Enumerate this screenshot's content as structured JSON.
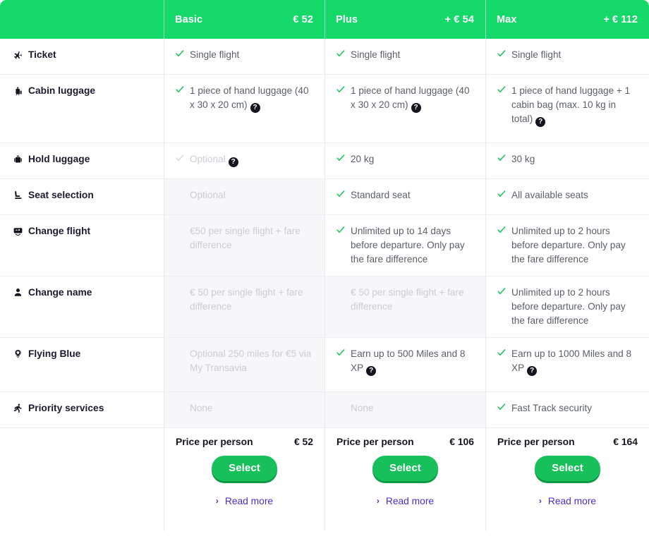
{
  "table": {
    "columns": [
      {
        "name": "Basic",
        "price": "€ 52"
      },
      {
        "name": "Plus",
        "price": "+ € 54"
      },
      {
        "name": "Max",
        "price": "+ € 112"
      }
    ],
    "rows": [
      {
        "label": "Ticket",
        "icon": "airplane-icon",
        "cells": [
          {
            "text": "Single flight",
            "check": "on",
            "state": "active",
            "help": false
          },
          {
            "text": "Single flight",
            "check": "on",
            "state": "active",
            "help": false
          },
          {
            "text": "Single flight",
            "check": "on",
            "state": "active",
            "help": false
          }
        ]
      },
      {
        "label": "Cabin luggage",
        "icon": "cabin-luggage-icon",
        "cells": [
          {
            "text": "1 piece of hand luggage (40 x 30 x 20 cm)",
            "check": "on",
            "state": "active",
            "help": true
          },
          {
            "text": "1 piece of hand luggage (40 x 30 x 20 cm)",
            "check": "on",
            "state": "active",
            "help": true
          },
          {
            "text": "1 piece of hand luggage + 1 cabin bag (max. 10 kg in total)",
            "check": "on",
            "state": "active",
            "help": true
          }
        ]
      },
      {
        "label": "Hold luggage",
        "icon": "hold-luggage-icon",
        "cells": [
          {
            "text": "Optional",
            "check": "faded",
            "state": "muted",
            "help": true
          },
          {
            "text": "20 kg",
            "check": "on",
            "state": "active",
            "help": false
          },
          {
            "text": "30 kg",
            "check": "on",
            "state": "active",
            "help": false
          }
        ]
      },
      {
        "label": "Seat selection",
        "icon": "seat-icon",
        "cells": [
          {
            "text": "Optional",
            "check": "none",
            "state": "disabled",
            "help": false
          },
          {
            "text": "Standard seat",
            "check": "on",
            "state": "active",
            "help": false
          },
          {
            "text": "All available seats",
            "check": "on",
            "state": "active",
            "help": false
          }
        ]
      },
      {
        "label": "Change flight",
        "icon": "change-flight-icon",
        "cells": [
          {
            "text": "€50 per single flight + fare difference",
            "check": "none",
            "state": "disabled",
            "help": false
          },
          {
            "text": "Unlimited up to 14 days before departure. Only pay the fare difference",
            "check": "on",
            "state": "active",
            "help": false
          },
          {
            "text": "Unlimited up to 2 hours before departure. Only pay the fare difference",
            "check": "on",
            "state": "active",
            "help": false
          }
        ]
      },
      {
        "label": "Change name",
        "icon": "person-icon",
        "cells": [
          {
            "text": "€ 50 per single flight + fare difference",
            "check": "none",
            "state": "disabled",
            "help": false
          },
          {
            "text": "€ 50 per single flight + fare difference",
            "check": "none",
            "state": "disabled",
            "help": false
          },
          {
            "text": "Unlimited up to 2 hours before departure. Only pay the fare difference",
            "check": "on",
            "state": "active",
            "help": false
          }
        ]
      },
      {
        "label": "Flying Blue",
        "icon": "flying-blue-icon",
        "cells": [
          {
            "text": "Optional 250 miles for €5 via My Transavia",
            "check": "none",
            "state": "disabled",
            "help": false
          },
          {
            "text": "Earn up to 500 Miles and 8 XP",
            "check": "on",
            "state": "active",
            "help": true
          },
          {
            "text": "Earn up to 1000 Miles and 8 XP",
            "check": "on",
            "state": "active",
            "help": true
          }
        ]
      },
      {
        "label": "Priority services",
        "icon": "priority-icon",
        "cells": [
          {
            "text": "None",
            "check": "none",
            "state": "disabled",
            "help": false
          },
          {
            "text": "None",
            "check": "none",
            "state": "disabled",
            "help": false
          },
          {
            "text": "Fast Track security",
            "check": "on",
            "state": "active",
            "help": false
          }
        ]
      }
    ],
    "footer": {
      "price_label": "Price per person",
      "select_label": "Select",
      "read_more_label": "Read more",
      "chevron": "›",
      "help_glyph": "?",
      "prices": [
        "€ 52",
        "€ 106",
        "€ 164"
      ]
    }
  },
  "colors": {
    "header_green": "#14d867",
    "check_green": "#22c55e",
    "button_green": "#18c05c",
    "button_shadow": "#0d9a47",
    "link_purple": "#4b2ec9",
    "text_dark": "#15151f",
    "text_body": "#5b6068",
    "text_muted": "#cbcdd3",
    "row_dim_bg": "#f7f7f9"
  }
}
